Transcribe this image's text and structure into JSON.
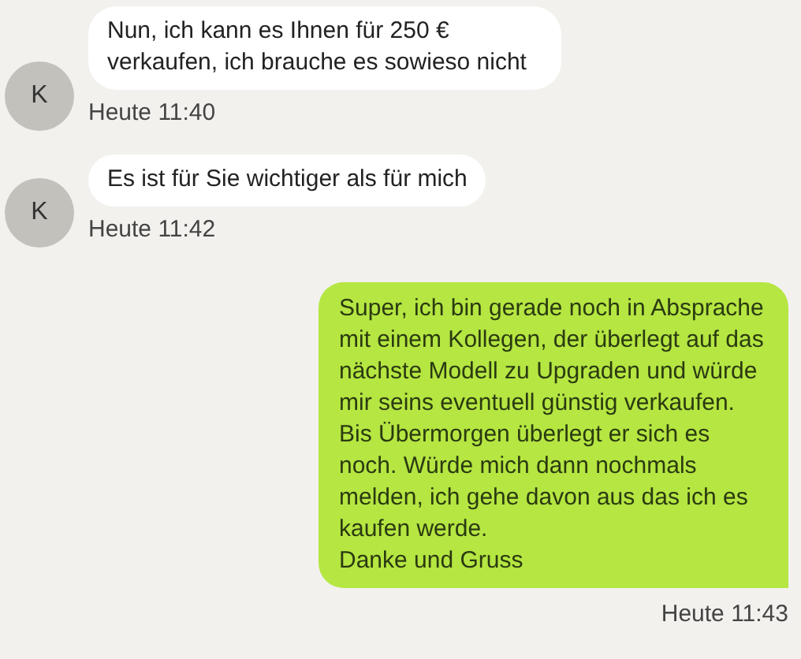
{
  "messages": [
    {
      "kind": "incoming",
      "avatar": "K",
      "text": "Nun, ich kann es Ihnen für 250 € verkaufen, ich brauche es sowieso nicht",
      "time": "Heute 11:40"
    },
    {
      "kind": "incoming",
      "avatar": "K",
      "text": "Es ist für Sie wichtiger als für mich",
      "time": "Heute 11:42"
    },
    {
      "kind": "outgoing",
      "text": "Super, ich bin gerade noch in Absprache mit einem Kollegen, der überlegt auf das nächste Modell zu Upgraden und würde mir seins eventuell günstig verkaufen. Bis Übermorgen überlegt er sich es noch. Würde mich dann nochmals melden, ich gehe davon aus das ich es kaufen werde.\nDanke und Gruss",
      "time": "Heute 11:43"
    }
  ]
}
